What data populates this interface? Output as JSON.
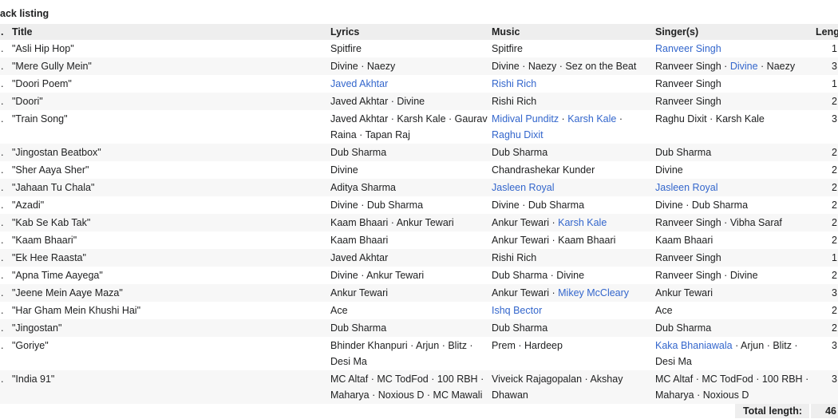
{
  "section_title": "ack listing",
  "columns": {
    "no": ".",
    "title": "Title",
    "lyrics": "Lyrics",
    "music": "Music",
    "singers": "Singer(s)",
    "length": "Leng"
  },
  "credit_separator": " · ",
  "tracks": [
    {
      "no": ".",
      "title": "\"Asli Hip Hop\"",
      "lyrics": [
        {
          "name": "Spitfire"
        }
      ],
      "music": [
        {
          "name": "Spitfire"
        }
      ],
      "singers": [
        {
          "name": "Ranveer Singh",
          "link": true
        }
      ],
      "length": "1"
    },
    {
      "no": ".",
      "title": "\"Mere Gully Mein\"",
      "lyrics": [
        {
          "name": "Divine"
        },
        {
          "name": "Naezy"
        }
      ],
      "music": [
        {
          "name": "Divine"
        },
        {
          "name": "Naezy"
        },
        {
          "name": "Sez on the Beat"
        }
      ],
      "singers": [
        {
          "name": "Ranveer Singh"
        },
        {
          "name": "Divine",
          "link": true
        },
        {
          "name": "Naezy"
        }
      ],
      "length": "3"
    },
    {
      "no": ".",
      "title": "\"Doori Poem\"",
      "lyrics": [
        {
          "name": "Javed Akhtar",
          "link": true
        }
      ],
      "music": [
        {
          "name": "Rishi Rich",
          "link": true
        }
      ],
      "singers": [
        {
          "name": "Ranveer Singh"
        }
      ],
      "length": "1"
    },
    {
      "no": ".",
      "title": "\"Doori\"",
      "lyrics": [
        {
          "name": "Javed Akhtar"
        },
        {
          "name": "Divine"
        }
      ],
      "music": [
        {
          "name": "Rishi Rich"
        }
      ],
      "singers": [
        {
          "name": "Ranveer Singh"
        }
      ],
      "length": "2"
    },
    {
      "no": ".",
      "title": "\"Train Song\"",
      "lyrics": [
        {
          "name": "Javed Akhtar"
        },
        {
          "name": "Karsh Kale"
        },
        {
          "name": "Gaurav Raina"
        },
        {
          "name": "Tapan Raj"
        }
      ],
      "music": [
        {
          "name": "Midival Punditz",
          "link": true
        },
        {
          "name": "Karsh Kale",
          "link": true
        },
        {
          "name": "Raghu Dixit",
          "link": true
        }
      ],
      "singers": [
        {
          "name": "Raghu Dixit"
        },
        {
          "name": "Karsh Kale"
        }
      ],
      "length": "3"
    },
    {
      "no": ".",
      "title": "\"Jingostan Beatbox\"",
      "lyrics": [
        {
          "name": "Dub Sharma"
        }
      ],
      "music": [
        {
          "name": "Dub Sharma"
        }
      ],
      "singers": [
        {
          "name": "Dub Sharma"
        }
      ],
      "length": "2"
    },
    {
      "no": ".",
      "title": "\"Sher Aaya Sher\"",
      "lyrics": [
        {
          "name": "Divine"
        }
      ],
      "music": [
        {
          "name": "Chandrashekar Kunder"
        }
      ],
      "singers": [
        {
          "name": "Divine"
        }
      ],
      "length": "2"
    },
    {
      "no": ".",
      "title": "\"Jahaan Tu Chala\"",
      "lyrics": [
        {
          "name": "Aditya Sharma"
        }
      ],
      "music": [
        {
          "name": "Jasleen Royal",
          "link": true
        }
      ],
      "singers": [
        {
          "name": "Jasleen Royal",
          "link": true
        }
      ],
      "length": "2"
    },
    {
      "no": ".",
      "title": "\"Azadi\"",
      "lyrics": [
        {
          "name": "Divine"
        },
        {
          "name": "Dub Sharma"
        }
      ],
      "music": [
        {
          "name": "Divine"
        },
        {
          "name": "Dub Sharma"
        }
      ],
      "singers": [
        {
          "name": "Divine"
        },
        {
          "name": "Dub Sharma"
        }
      ],
      "length": "2"
    },
    {
      "no": ".",
      "title": "\"Kab Se Kab Tak\"",
      "lyrics": [
        {
          "name": "Kaam Bhaari"
        },
        {
          "name": "Ankur Tewari"
        }
      ],
      "music": [
        {
          "name": "Ankur Tewari"
        },
        {
          "name": "Karsh Kale",
          "link": true
        }
      ],
      "singers": [
        {
          "name": "Ranveer Singh"
        },
        {
          "name": "Vibha Saraf"
        }
      ],
      "length": "2"
    },
    {
      "no": ".",
      "title": "\"Kaam Bhaari\"",
      "lyrics": [
        {
          "name": "Kaam Bhaari"
        }
      ],
      "music": [
        {
          "name": "Ankur Tewari"
        },
        {
          "name": "Kaam Bhaari"
        }
      ],
      "singers": [
        {
          "name": "Kaam Bhaari"
        }
      ],
      "length": "2"
    },
    {
      "no": ".",
      "title": "\"Ek Hee Raasta\"",
      "lyrics": [
        {
          "name": "Javed Akhtar"
        }
      ],
      "music": [
        {
          "name": "Rishi Rich"
        }
      ],
      "singers": [
        {
          "name": "Ranveer Singh"
        }
      ],
      "length": "1"
    },
    {
      "no": ".",
      "title": "\"Apna Time Aayega\"",
      "lyrics": [
        {
          "name": "Divine"
        },
        {
          "name": "Ankur Tewari"
        }
      ],
      "music": [
        {
          "name": "Dub Sharma"
        },
        {
          "name": "Divine"
        }
      ],
      "singers": [
        {
          "name": "Ranveer Singh"
        },
        {
          "name": "Divine"
        }
      ],
      "length": "2"
    },
    {
      "no": ".",
      "title": "\"Jeene Mein Aaye Maza\"",
      "lyrics": [
        {
          "name": "Ankur Tewari"
        }
      ],
      "music": [
        {
          "name": "Ankur Tewari"
        },
        {
          "name": "Mikey McCleary",
          "link": true
        }
      ],
      "singers": [
        {
          "name": "Ankur Tewari"
        }
      ],
      "length": "3"
    },
    {
      "no": ".",
      "title": "\"Har Gham Mein Khushi Hai\"",
      "lyrics": [
        {
          "name": "Ace"
        }
      ],
      "music": [
        {
          "name": "Ishq Bector",
          "link": true
        }
      ],
      "singers": [
        {
          "name": "Ace"
        }
      ],
      "length": "2"
    },
    {
      "no": ".",
      "title": "\"Jingostan\"",
      "lyrics": [
        {
          "name": "Dub Sharma"
        }
      ],
      "music": [
        {
          "name": "Dub Sharma"
        }
      ],
      "singers": [
        {
          "name": "Dub Sharma"
        }
      ],
      "length": "2"
    },
    {
      "no": ".",
      "title": "\"Goriye\"",
      "lyrics": [
        {
          "name": "Bhinder Khanpuri"
        },
        {
          "name": "Arjun"
        },
        {
          "name": "Blitz"
        },
        {
          "name": "Desi Ma"
        }
      ],
      "music": [
        {
          "name": "Prem"
        },
        {
          "name": "Hardeep"
        }
      ],
      "singers": [
        {
          "name": "Kaka Bhaniawala",
          "link": true
        },
        {
          "name": "Arjun"
        },
        {
          "name": "Blitz"
        },
        {
          "name": "Desi Ma"
        }
      ],
      "length": "3"
    },
    {
      "no": ".",
      "title": "\"India 91\"",
      "lyrics": [
        {
          "name": "MC Altaf"
        },
        {
          "name": "MC TodFod"
        },
        {
          "name": "100 RBH"
        },
        {
          "name": "Maharya"
        },
        {
          "name": "Noxious D"
        },
        {
          "name": "MC Mawali"
        }
      ],
      "music": [
        {
          "name": "Viveick Rajagopalan"
        },
        {
          "name": "Akshay Dhawan"
        }
      ],
      "singers": [
        {
          "name": "MC Altaf"
        },
        {
          "name": "MC TodFod"
        },
        {
          "name": "100 RBH"
        },
        {
          "name": "Maharya"
        },
        {
          "name": "Noxious D"
        }
      ],
      "length": "3"
    }
  ],
  "total": {
    "label": "Total length:",
    "value": "46"
  },
  "colors": {
    "text": "#202122",
    "link": "#3366cc",
    "header_bg": "#eeeeee",
    "alt_row_bg": "#f7f7f7",
    "total_bg": "#eeeeee"
  }
}
